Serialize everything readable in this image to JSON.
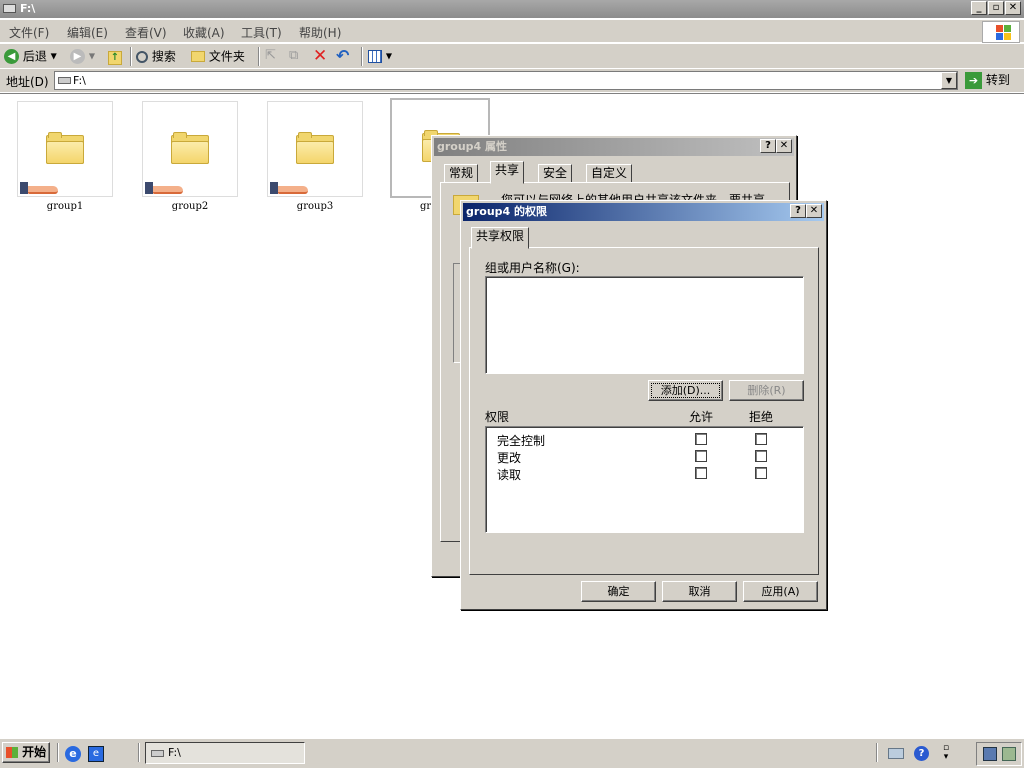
{
  "window": {
    "title": "F:\\"
  },
  "menu": {
    "items": [
      "文件(F)",
      "编辑(E)",
      "查看(V)",
      "收藏(A)",
      "工具(T)",
      "帮助(H)"
    ]
  },
  "toolbar": {
    "back_label": "后退",
    "search_label": "搜索",
    "folders_label": "文件夹"
  },
  "address": {
    "label": "地址(D)",
    "value": "F:\\",
    "go_label": "转到"
  },
  "folders": [
    {
      "name": "group1"
    },
    {
      "name": "group2"
    },
    {
      "name": "group3"
    },
    {
      "name": "gr"
    }
  ],
  "properties_dialog": {
    "title": "group4 属性",
    "tabs": [
      "常规",
      "共享",
      "安全",
      "自定义"
    ],
    "active_tab": "共享",
    "partial_text": "您可以与网络上的其他用户共享该文件夹。要共享"
  },
  "permissions_dialog": {
    "title": "group4 的权限",
    "tab": "共享权限",
    "users_label": "组或用户名称(G):",
    "add_button": "添加(D)...",
    "remove_button": "删除(R)",
    "perm_header": "权限",
    "allow_header": "允许",
    "deny_header": "拒绝",
    "permissions": [
      {
        "name": "完全控制",
        "allow": false,
        "deny": false
      },
      {
        "name": "更改",
        "allow": false,
        "deny": false
      },
      {
        "name": "读取",
        "allow": false,
        "deny": false
      }
    ],
    "ok_button": "确定",
    "cancel_button": "取消",
    "apply_button": "应用(A)"
  },
  "taskbar": {
    "start_label": "开始",
    "task_label": "F:\\"
  },
  "colors": {
    "active_title_start": "#0a246a",
    "active_title_end": "#a6caf0",
    "inactive_title_start": "#808080",
    "inactive_title_end": "#c0c0c0",
    "face": "#d4d0c8"
  }
}
